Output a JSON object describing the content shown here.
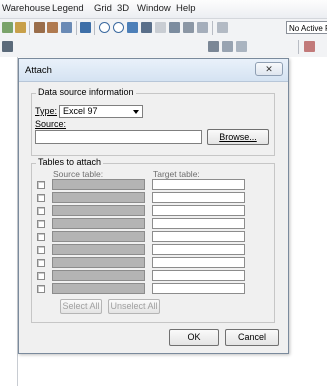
{
  "menu": [
    "Warehouse",
    "Legend",
    "Grid",
    "3D",
    "Window",
    "Help"
  ],
  "toolbar": {
    "active_layer": "No Active F"
  },
  "dialog": {
    "title": "Attach",
    "close_icon": "close-icon",
    "data_source": {
      "legend": "Data source information",
      "type_label": "Type:",
      "type_value": "Excel 97",
      "source_label": "Source:",
      "source_value": "",
      "browse_label": "Browse..."
    },
    "tables": {
      "legend": "Tables to attach",
      "source_header": "Source table:",
      "target_header": "Target table:",
      "rows": [
        {
          "checked": false,
          "source": "",
          "target": ""
        },
        {
          "checked": false,
          "source": "",
          "target": ""
        },
        {
          "checked": false,
          "source": "",
          "target": ""
        },
        {
          "checked": false,
          "source": "",
          "target": ""
        },
        {
          "checked": false,
          "source": "",
          "target": ""
        },
        {
          "checked": false,
          "source": "",
          "target": ""
        },
        {
          "checked": false,
          "source": "",
          "target": ""
        },
        {
          "checked": false,
          "source": "",
          "target": ""
        },
        {
          "checked": false,
          "source": "",
          "target": ""
        }
      ],
      "select_all_label": "Select All",
      "unselect_all_label": "Unselect All"
    },
    "ok_label": "OK",
    "cancel_label": "Cancel"
  }
}
